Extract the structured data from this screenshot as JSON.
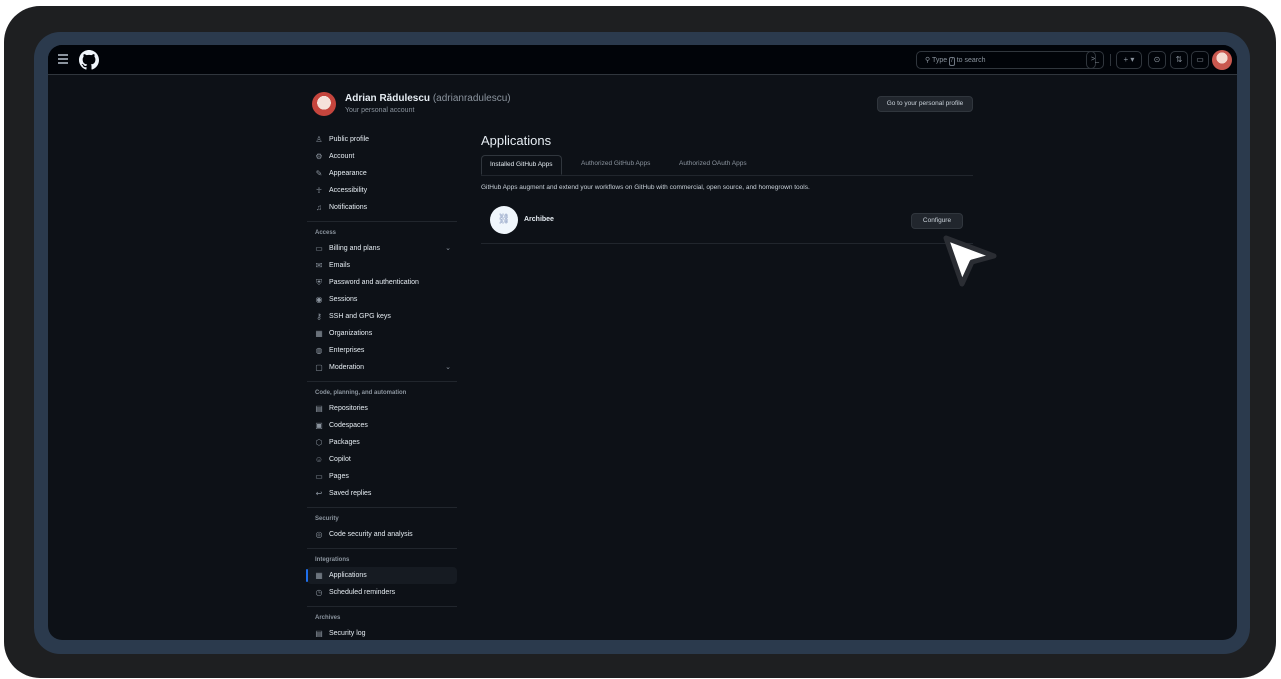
{
  "header": {
    "search_label": "Type",
    "search_key": "/",
    "search_suffix": "to search",
    "command_label": ">_",
    "plus_label": "+ ▾",
    "icons": [
      "menu-icon",
      "github-logo-icon",
      "search-icon",
      "command-palette-icon",
      "plus-icon",
      "issues-icon",
      "pull-requests-icon",
      "inbox-icon"
    ]
  },
  "user": {
    "name": "Adrian Rădulescu",
    "handle": "(adrianradulescu)",
    "subtitle": "Your personal account",
    "profile_button": "Go to your personal profile"
  },
  "sidebar": {
    "groups": [
      {
        "heading": "",
        "items": [
          {
            "label": "Public profile",
            "icon": "person-icon"
          },
          {
            "label": "Account",
            "icon": "gear-icon"
          },
          {
            "label": "Appearance",
            "icon": "paintbrush-icon"
          },
          {
            "label": "Accessibility",
            "icon": "accessibility-icon"
          },
          {
            "label": "Notifications",
            "icon": "bell-icon"
          }
        ]
      },
      {
        "heading": "Access",
        "items": [
          {
            "label": "Billing and plans",
            "icon": "credit-card-icon",
            "expandable": true
          },
          {
            "label": "Emails",
            "icon": "mail-icon"
          },
          {
            "label": "Password and authentication",
            "icon": "shield-lock-icon"
          },
          {
            "label": "Sessions",
            "icon": "broadcast-icon"
          },
          {
            "label": "SSH and GPG keys",
            "icon": "key-icon"
          },
          {
            "label": "Organizations",
            "icon": "organization-icon"
          },
          {
            "label": "Enterprises",
            "icon": "globe-icon"
          },
          {
            "label": "Moderation",
            "icon": "report-icon",
            "expandable": true
          }
        ]
      },
      {
        "heading": "Code, planning, and automation",
        "items": [
          {
            "label": "Repositories",
            "icon": "repo-icon"
          },
          {
            "label": "Codespaces",
            "icon": "codespaces-icon"
          },
          {
            "label": "Packages",
            "icon": "package-icon"
          },
          {
            "label": "Copilot",
            "icon": "copilot-icon"
          },
          {
            "label": "Pages",
            "icon": "browser-icon"
          },
          {
            "label": "Saved replies",
            "icon": "reply-icon"
          }
        ]
      },
      {
        "heading": "Security",
        "items": [
          {
            "label": "Code security and analysis",
            "icon": "codescan-icon"
          }
        ]
      },
      {
        "heading": "Integrations",
        "items": [
          {
            "label": "Applications",
            "icon": "apps-icon",
            "active": true
          },
          {
            "label": "Scheduled reminders",
            "icon": "clock-icon"
          }
        ]
      },
      {
        "heading": "Archives",
        "items": [
          {
            "label": "Security log",
            "icon": "log-icon"
          }
        ]
      }
    ]
  },
  "main": {
    "title": "Applications",
    "tabs": [
      {
        "label": "Installed GitHub Apps",
        "selected": true
      },
      {
        "label": "Authorized GitHub Apps",
        "selected": false
      },
      {
        "label": "Authorized OAuth Apps",
        "selected": false
      }
    ],
    "description": "GitHub Apps augment and extend your workflows on GitHub with commercial, open source, and homegrown tools.",
    "apps": [
      {
        "name": "Archibee",
        "button": "Configure"
      }
    ]
  }
}
